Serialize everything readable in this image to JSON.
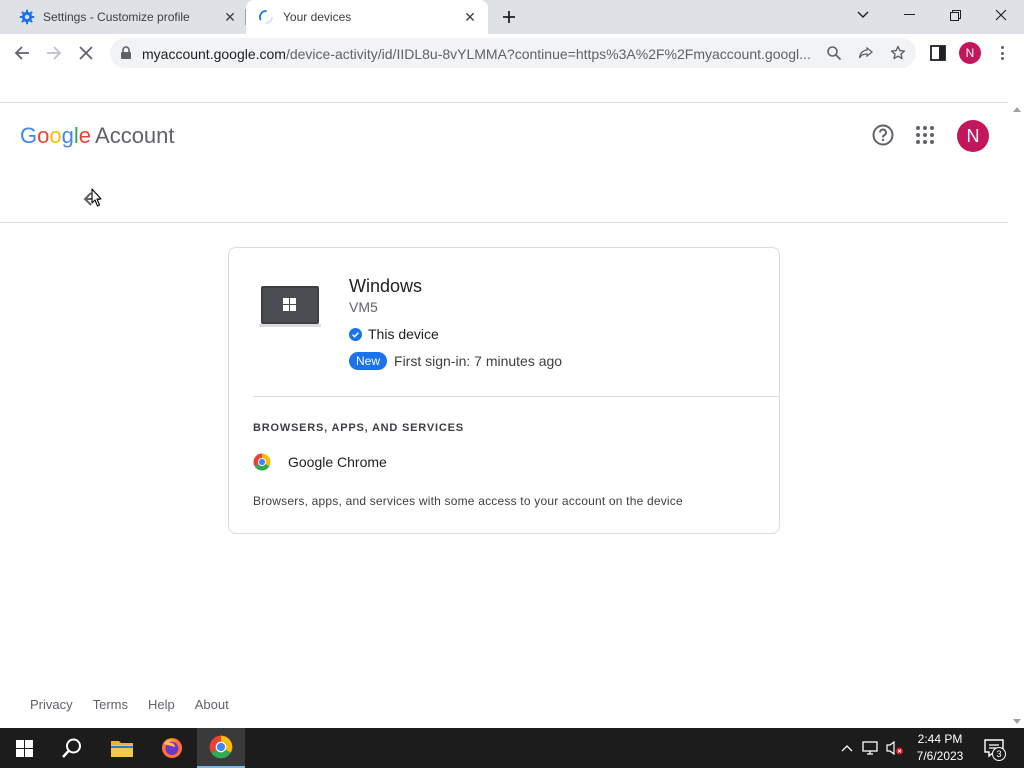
{
  "browser": {
    "tabs": [
      {
        "title": "Settings - Customize profile",
        "icon": "gear-icon",
        "active": false
      },
      {
        "title": "Your devices",
        "icon": "loading-spinner-icon",
        "active": true
      }
    ],
    "url_host": "myaccount.google.com",
    "url_path": "/device-activity/id/IIDL8u-8vYLMMA?continue=https%3A%2F%2Fmyaccount.googl...",
    "profile_initial": "N"
  },
  "header": {
    "logo_google": "Google",
    "logo_account": "Account",
    "avatar_initial": "N"
  },
  "device": {
    "name": "Windows",
    "model": "VM5",
    "this_device": "This device",
    "badge": "New",
    "first_signin": "First sign-in: 7 minutes ago"
  },
  "services": {
    "heading": "BROWSERS, APPS, AND SERVICES",
    "items": [
      {
        "name": "Google Chrome",
        "icon": "chrome-icon"
      }
    ],
    "note": "Browsers, apps, and services with some access to your account on the device"
  },
  "footer": {
    "links": [
      "Privacy",
      "Terms",
      "Help",
      "About"
    ]
  },
  "taskbar": {
    "time": "2:44 PM",
    "date": "7/6/2023",
    "notification_count": "3"
  },
  "colors": {
    "avatar": "#c2185b",
    "badge": "#1a73e8",
    "google_blue": "#4285f4",
    "google_red": "#ea4335",
    "google_yellow": "#fbbc05",
    "google_green": "#34a853"
  }
}
